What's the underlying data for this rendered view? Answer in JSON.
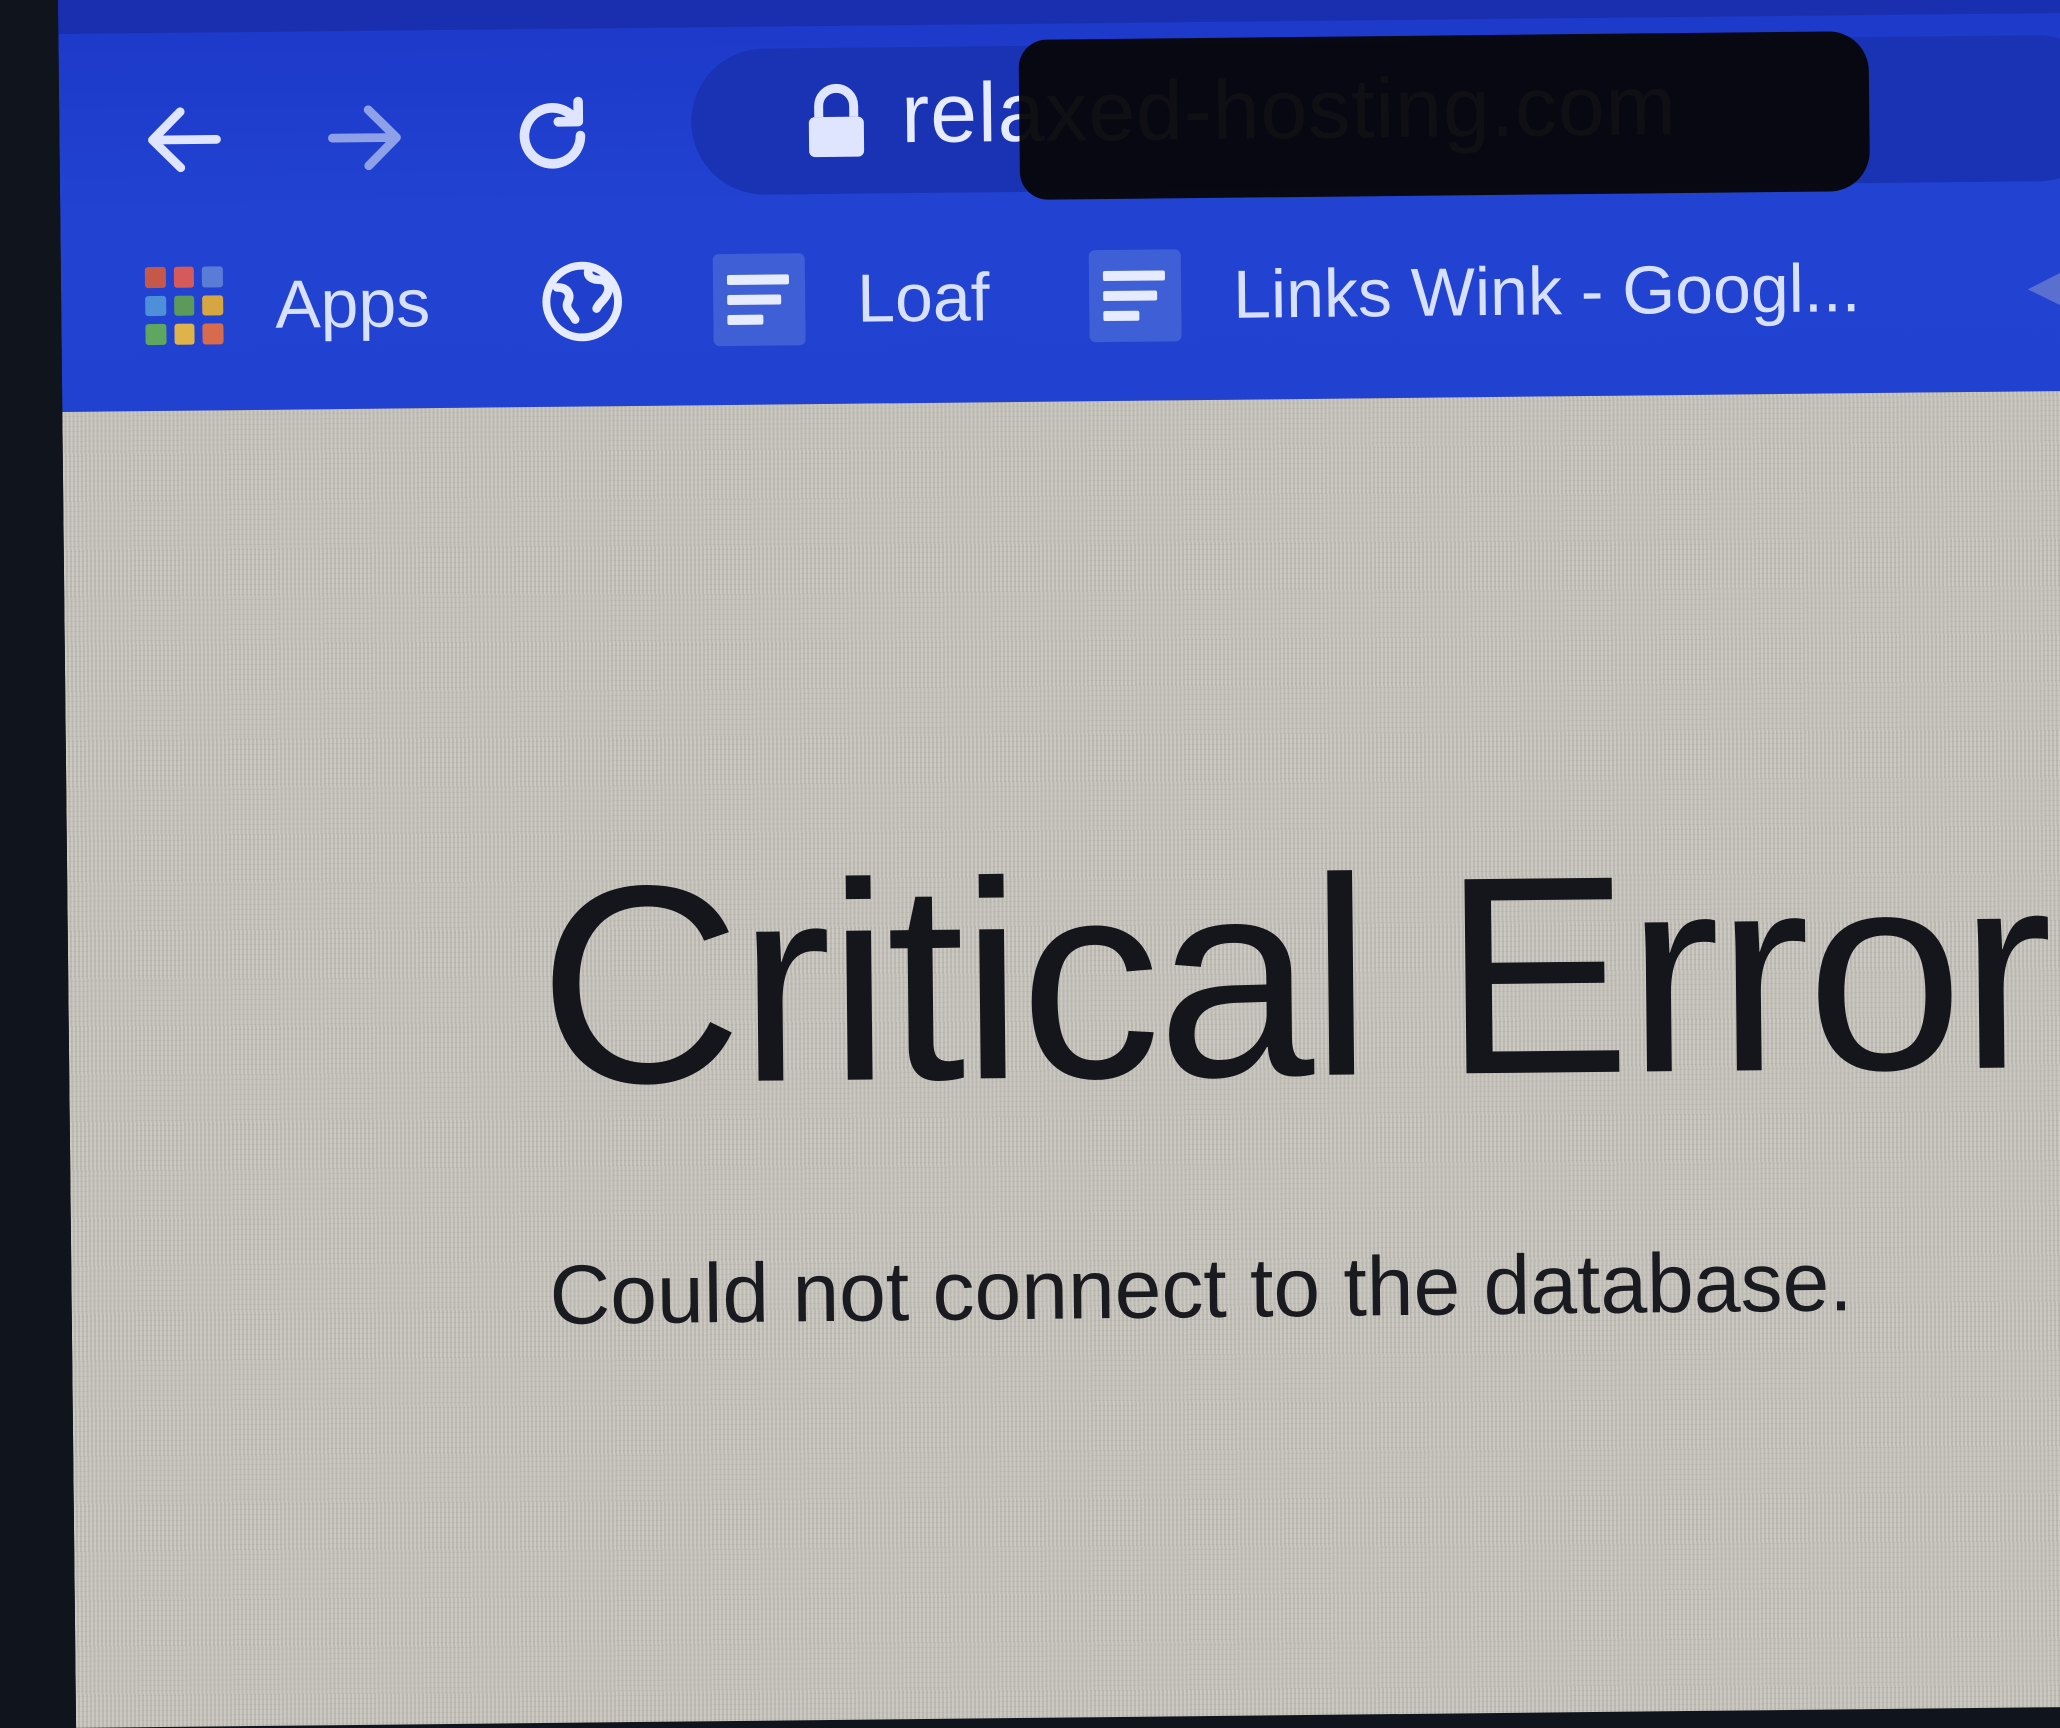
{
  "toolbar": {
    "back_icon": "arrow-left-icon",
    "forward_icon": "arrow-right-icon",
    "reload_icon": "reload-icon"
  },
  "omnibox": {
    "lock_icon": "lock-icon",
    "url": "relaxed-hosting.com"
  },
  "bookmarks": {
    "items": [
      {
        "label": "Apps",
        "icon": "apps-grid-icon"
      },
      {
        "label": "",
        "icon": "globe-icon"
      },
      {
        "label": "Loaf",
        "icon": "document-icon"
      },
      {
        "label": "Links Wink - Googl...",
        "icon": "document-icon"
      }
    ]
  },
  "page": {
    "title": "Critical Error",
    "message": "Could not connect to the database."
  },
  "colors": {
    "chrome_bg": "#2142d0",
    "omnibox_bg": "#1a33b4",
    "page_bg": "#c6c3bc",
    "text": "#15161b"
  }
}
